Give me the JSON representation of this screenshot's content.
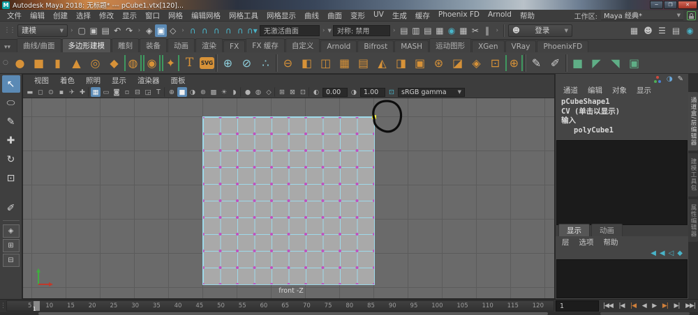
{
  "colors": {
    "accent-blue": "#5b8ab5",
    "shelf-orange": "#d79238",
    "icon-teal": "#49b4c9",
    "icon-green": "#5fae86",
    "wire-cyan": "#9ed9ea",
    "vertex-magenta": "#c052c0",
    "selected-yellow": "#f4ef3a",
    "viewport-gray": "#6a6a6a",
    "grid-line": "#5b5b5b",
    "face-gray": "#a9a9a9"
  },
  "titlebar": {
    "app_initial": "M",
    "title": "Autodesk Maya 2018: 无标题*  ---  pCube1.vtx[120]...",
    "minimize": "─",
    "maximize": "❐",
    "close": "✕"
  },
  "menubar": {
    "items": [
      {
        "name": "menu-file",
        "label": "文件"
      },
      {
        "name": "menu-edit",
        "label": "编辑"
      },
      {
        "name": "menu-create",
        "label": "创建"
      },
      {
        "name": "menu-select",
        "label": "选择"
      },
      {
        "name": "menu-modify",
        "label": "修改"
      },
      {
        "name": "menu-display",
        "label": "显示"
      },
      {
        "name": "menu-windows",
        "label": "窗口"
      },
      {
        "name": "menu-mesh",
        "label": "网格"
      },
      {
        "name": "menu-edit-mesh",
        "label": "编辑网格"
      },
      {
        "name": "menu-mesh-tools",
        "label": "网格工具"
      },
      {
        "name": "menu-mesh-display",
        "label": "网格显示"
      },
      {
        "name": "menu-curves",
        "label": "曲线"
      },
      {
        "name": "menu-surfaces",
        "label": "曲面"
      },
      {
        "name": "menu-deform",
        "label": "变形"
      },
      {
        "name": "menu-uv",
        "label": "UV"
      },
      {
        "name": "menu-generate",
        "label": "生成"
      },
      {
        "name": "menu-cache",
        "label": "缓存"
      },
      {
        "name": "menu-phoenix-fd",
        "label": "Phoenix FD"
      },
      {
        "name": "menu-arnold",
        "label": "Arnold"
      },
      {
        "name": "menu-help",
        "label": "帮助"
      }
    ],
    "workspace_label": "工作区:",
    "workspace_value": "Maya 经典*",
    "dropdown_arrow": "▼"
  },
  "statusline": {
    "mode": "建模",
    "no_active_surface": "无激活曲面",
    "symmetry": "对称: 禁用",
    "login": "登录",
    "file_icons": [
      {
        "name": "new-scene-icon",
        "glyph": "▢"
      },
      {
        "name": "open-scene-icon",
        "glyph": "▣"
      },
      {
        "name": "save-scene-icon",
        "glyph": "▤"
      },
      {
        "name": "undo-icon",
        "glyph": "↶"
      },
      {
        "name": "redo-icon",
        "glyph": "↷"
      }
    ],
    "selection_icons": [
      {
        "name": "select-hierarchy-icon",
        "glyph": "◈"
      },
      {
        "name": "select-object-icon",
        "glyph": "▣",
        "cls": "active"
      },
      {
        "name": "select-component-icon",
        "glyph": "◇"
      }
    ],
    "snap_icons": [
      {
        "name": "snap-to-grids-icon",
        "glyph": "∩",
        "cls": "teal"
      },
      {
        "name": "snap-to-curves-icon",
        "glyph": "∩",
        "cls": "teal"
      },
      {
        "name": "snap-to-points-icon",
        "glyph": "∩",
        "cls": "teal"
      },
      {
        "name": "snap-to-projected-center-icon",
        "glyph": "∩",
        "cls": "teal"
      },
      {
        "name": "snap-to-view-planes-icon",
        "glyph": "∩",
        "cls": "teal"
      },
      {
        "name": "make-live-icon",
        "glyph": "∩▾",
        "cls": "teal"
      }
    ],
    "render_icons": [
      {
        "name": "render-view-icon",
        "glyph": "▤"
      },
      {
        "name": "render-current-frame-icon",
        "glyph": "▥"
      },
      {
        "name": "ipr-render-icon",
        "glyph": "▤"
      },
      {
        "name": "render-setup-icon",
        "glyph": "▦"
      },
      {
        "name": "launch-render-view-icon",
        "glyph": "◉",
        "cls": "teal"
      },
      {
        "name": "render-settings-icon",
        "glyph": "▦"
      },
      {
        "name": "cut-icon",
        "glyph": "✂"
      },
      {
        "name": "pause-icon",
        "glyph": "‖"
      }
    ],
    "right_icons": [
      {
        "name": "modeling-toolkit-toggle-icon",
        "glyph": "▦"
      },
      {
        "name": "humanik-toggle-icon",
        "glyph": "☻"
      },
      {
        "name": "channel-box-toggle-icon",
        "glyph": "☰"
      },
      {
        "name": "attribute-editor-toggle-icon",
        "glyph": "▤"
      },
      {
        "name": "tool-settings-toggle-icon",
        "glyph": "◉",
        "cls": "teal"
      }
    ],
    "login_icon": "☻",
    "chevron": "›",
    "grip": "⋮⋮"
  },
  "shelf": {
    "tabs": [
      {
        "name": "shelf-tab-curves-surfaces",
        "label": "曲线/曲面"
      },
      {
        "name": "shelf-tab-poly-modeling",
        "label": "多边形建模",
        "cls": "active"
      },
      {
        "name": "shelf-tab-sculpting",
        "label": "雕刻"
      },
      {
        "name": "shelf-tab-rigging",
        "label": "装备"
      },
      {
        "name": "shelf-tab-animation",
        "label": "动画"
      },
      {
        "name": "shelf-tab-rendering",
        "label": "渲染"
      },
      {
        "name": "shelf-tab-fx",
        "label": "FX"
      },
      {
        "name": "shelf-tab-fx-caching",
        "label": "FX 缓存"
      },
      {
        "name": "shelf-tab-custom",
        "label": "自定义"
      },
      {
        "name": "shelf-tab-arnold",
        "label": "Arnold"
      },
      {
        "name": "shelf-tab-bifrost",
        "label": "Bifrost"
      },
      {
        "name": "shelf-tab-mash",
        "label": "MASH"
      },
      {
        "name": "shelf-tab-motion-graphics",
        "label": "运动图形"
      },
      {
        "name": "shelf-tab-xgen",
        "label": "XGen"
      },
      {
        "name": "shelf-tab-vray",
        "label": "VRay"
      },
      {
        "name": "shelf-tab-phoenixfd",
        "label": "PhoenixFD"
      }
    ],
    "icons": [
      {
        "name": "poly-sphere-icon",
        "glyph": "●"
      },
      {
        "name": "poly-cube-icon",
        "glyph": "■"
      },
      {
        "name": "poly-cylinder-icon",
        "glyph": "▮"
      },
      {
        "name": "poly-cone-icon",
        "glyph": "▲"
      },
      {
        "name": "poly-torus-icon",
        "glyph": "◎"
      },
      {
        "name": "poly-plane-icon",
        "glyph": "◆"
      },
      {
        "name": "poly-disc-icon",
        "glyph": "◍",
        "cls": "bracket"
      },
      {
        "name": "platonic-solid-icon",
        "glyph": "◉",
        "cls": "bracket"
      },
      {
        "name": "super-shape-icon",
        "glyph": "✦",
        "cls": "bracket"
      },
      {
        "name": "poly-text-icon",
        "glyph": "T",
        "cls": "textT"
      },
      {
        "name": "svg-tool-icon",
        "glyph": "SVG",
        "cls": "badge"
      },
      {
        "name": "shelf-separator",
        "glyph": "",
        "cls": "sepv"
      },
      {
        "name": "center-pivot-icon",
        "glyph": "⊕",
        "color": "#8ecfdd"
      },
      {
        "name": "delete-history-icon",
        "glyph": "⊘",
        "color": "#8ecfdd"
      },
      {
        "name": "zero-transforms-icon",
        "glyph": "∴",
        "color": "#8ecfdd"
      },
      {
        "name": "shelf-separator",
        "glyph": "",
        "cls": "sepv"
      },
      {
        "name": "combine-icon",
        "glyph": "⊖"
      },
      {
        "name": "boolean-icon",
        "glyph": "◧"
      },
      {
        "name": "mirror-icon",
        "glyph": "◫"
      },
      {
        "name": "fill-hole-icon",
        "glyph": "▦"
      },
      {
        "name": "reduce-icon",
        "glyph": "▤"
      },
      {
        "name": "smooth-icon",
        "glyph": "◭"
      },
      {
        "name": "extrude-icon",
        "glyph": "◨"
      },
      {
        "name": "bridge-icon",
        "glyph": "▣"
      },
      {
        "name": "circularize-icon",
        "glyph": "⊛"
      },
      {
        "name": "bevel-icon",
        "glyph": "◪"
      },
      {
        "name": "multi-cut-icon",
        "glyph": "◈"
      },
      {
        "name": "target-weld-icon",
        "glyph": "⊡"
      },
      {
        "name": "sphere-project-icon",
        "glyph": "⊕",
        "cls": "bracket"
      },
      {
        "name": "shelf-separator",
        "glyph": "",
        "cls": "sepv"
      },
      {
        "name": "create-curve-icon",
        "glyph": "✎",
        "color": "#cfcfcf"
      },
      {
        "name": "edit-points-icon",
        "glyph": "✐",
        "color": "#cfcfcf"
      },
      {
        "name": "shelf-separator",
        "glyph": "",
        "cls": "sepv"
      },
      {
        "name": "quad-draw-icon",
        "glyph": "■",
        "color": "#5fae86"
      },
      {
        "name": "relax-icon",
        "glyph": "◤",
        "color": "#5fae86"
      },
      {
        "name": "tweak-icon",
        "glyph": "◥",
        "color": "#5fae86"
      },
      {
        "name": "grab-icon",
        "glyph": "▣",
        "color": "#5fae86"
      }
    ]
  },
  "toolbox": {
    "tools": [
      {
        "name": "select-tool",
        "glyph": "↖",
        "cls": "active"
      },
      {
        "name": "lasso-select-tool",
        "glyph": "⬭"
      },
      {
        "name": "paint-select-tool",
        "glyph": "✎"
      },
      {
        "name": "move-tool",
        "glyph": "✚"
      },
      {
        "name": "rotate-tool",
        "glyph": "↻"
      },
      {
        "name": "scale-tool",
        "glyph": "⊡"
      },
      {
        "name": "tool-spacer",
        "glyph": "",
        "cls": "spacer"
      },
      {
        "name": "last-tool",
        "glyph": "✐"
      }
    ],
    "layouts": [
      {
        "name": "layout-single-pane-button",
        "glyph": "◈"
      },
      {
        "name": "layout-four-pane-button",
        "glyph": "⊞"
      },
      {
        "name": "layout-two-pane-button",
        "glyph": "⊟"
      }
    ]
  },
  "panel_menu": [
    {
      "name": "panel-menu-view",
      "label": "视图"
    },
    {
      "name": "panel-menu-shading",
      "label": "着色"
    },
    {
      "name": "panel-menu-lighting",
      "label": "照明"
    },
    {
      "name": "panel-menu-show",
      "label": "显示"
    },
    {
      "name": "panel-menu-renderer",
      "label": "渲染器"
    },
    {
      "name": "panel-menu-panels",
      "label": "面板"
    }
  ],
  "viewport_bar": {
    "icons": [
      {
        "name": "camera-attributes-icon",
        "glyph": "▬"
      },
      {
        "name": "bookmark-icon",
        "glyph": "◻"
      },
      {
        "name": "image-plane-icon",
        "glyph": "⊙"
      },
      {
        "name": "two-d-pan-zoom-icon",
        "glyph": "▪"
      },
      {
        "name": "oriented-camera-icon",
        "glyph": "✈"
      },
      {
        "name": "snap-pivot-icon",
        "glyph": "✚"
      },
      {
        "name": "vp-separator",
        "glyph": "",
        "cls": "sepv"
      },
      {
        "name": "grid-toggle-icon",
        "glyph": "▦",
        "cls": "active"
      },
      {
        "name": "film-gate-icon",
        "glyph": "▭"
      },
      {
        "name": "resolution-gate-icon",
        "glyph": "◙"
      },
      {
        "name": "gate-mask-icon",
        "glyph": "▫"
      },
      {
        "name": "field-chart-icon",
        "glyph": "⊟"
      },
      {
        "name": "safe-action-icon",
        "glyph": "◲"
      },
      {
        "name": "safe-title-icon",
        "glyph": "T"
      },
      {
        "name": "vp-separator",
        "glyph": "",
        "cls": "sepv"
      },
      {
        "name": "wireframe-display-icon",
        "glyph": "⊕"
      },
      {
        "name": "shaded-display-icon",
        "glyph": "■",
        "cls": "active"
      },
      {
        "name": "textured-display-icon",
        "glyph": "◑"
      },
      {
        "name": "lighting-display-icon",
        "glyph": "⊛"
      },
      {
        "name": "shadows-icon",
        "glyph": "▩"
      },
      {
        "name": "ao-icon",
        "glyph": "☀"
      },
      {
        "name": "motion-blur-icon",
        "glyph": "◗"
      },
      {
        "name": "vp-separator",
        "glyph": "",
        "cls": "sepv"
      },
      {
        "name": "isolate-select-icon",
        "glyph": "●"
      },
      {
        "name": "xray-icon",
        "glyph": "◍"
      },
      {
        "name": "joints-xray-icon",
        "glyph": "◇"
      },
      {
        "name": "vp-separator",
        "glyph": "",
        "cls": "sepv"
      },
      {
        "name": "layer-overrides-icon",
        "glyph": "⊞"
      },
      {
        "name": "texture-borders-icon",
        "glyph": "⊠"
      },
      {
        "name": "screen-space-icon",
        "glyph": "⊡"
      },
      {
        "name": "vp-separator",
        "glyph": "",
        "cls": "sepv"
      }
    ],
    "exposure_icon": "◐",
    "exposure": "0.00",
    "contrast_icon": "◑",
    "contrast": "1.00",
    "cms_icon": "⊡",
    "color_space": "sRGB gamma",
    "dropdown_arrow": "▼"
  },
  "viewport": {
    "camera_label": "front -Z",
    "object_name": "pCube1",
    "grid_divisions": 10,
    "selected_vertex": "vtx[120] (top-right corner, yellow)"
  },
  "channel_box": {
    "top_icons": [
      {
        "name": "show-connections-icon",
        "glyph": "∴"
      },
      {
        "name": "hide-show-icon",
        "glyph": "◑",
        "color": "#6aa7d8"
      },
      {
        "name": "edit-channels-icon",
        "glyph": "✎",
        "color": "#c9c9c9"
      }
    ],
    "menu": [
      {
        "name": "channel-box-menu-channels",
        "label": "通道"
      },
      {
        "name": "channel-box-menu-edit",
        "label": "编辑"
      },
      {
        "name": "channel-box-menu-object",
        "label": "对象"
      },
      {
        "name": "channel-box-menu-show",
        "label": "显示"
      }
    ],
    "node": "pCubeShape1",
    "cv_hint": "CV (单击以显示)",
    "inputs_label": "输入",
    "input_node": "polyCube1"
  },
  "layer_editor": {
    "tabs": [
      {
        "name": "layer-tab-display",
        "label": "显示",
        "cls": "active"
      },
      {
        "name": "layer-tab-anim",
        "label": "动画"
      }
    ],
    "menu": [
      {
        "name": "layer-menu-layers",
        "label": "层"
      },
      {
        "name": "layer-menu-options",
        "label": "选项"
      },
      {
        "name": "layer-menu-help",
        "label": "帮助"
      }
    ],
    "icons": [
      {
        "name": "new-empty-layer-icon",
        "glyph": "◀"
      },
      {
        "name": "new-layer-selected-icon",
        "glyph": "◀"
      },
      {
        "name": "new-layer-icon",
        "glyph": "◁"
      },
      {
        "name": "layer-options-icon",
        "glyph": "◆"
      }
    ]
  },
  "right_tabs": [
    {
      "name": "vtab-channel-box-layer-editor",
      "label": "通道盒/层编辑器",
      "cls": "active"
    },
    {
      "name": "vtab-modeling-toolkit",
      "label": "建模工具包"
    },
    {
      "name": "vtab-attribute-editor",
      "label": "属性编辑器"
    }
  ],
  "timeline": {
    "ticks": [
      "5",
      "10",
      "15",
      "20",
      "25",
      "30",
      "35",
      "40",
      "45",
      "50",
      "55",
      "60",
      "65",
      "70",
      "75",
      "80",
      "85",
      "90",
      "95",
      "100",
      "105",
      "110",
      "115",
      "120"
    ],
    "current_frame": "1",
    "frame_field": "1",
    "grip": "⋮",
    "playback": [
      {
        "name": "go-to-start-button",
        "glyph": "|◀◀"
      },
      {
        "name": "step-back-frame-button",
        "glyph": "|◀"
      },
      {
        "name": "step-back-key-button",
        "glyph": "|◀",
        "cls": "key"
      },
      {
        "name": "play-backwards-button",
        "glyph": "◀"
      },
      {
        "name": "play-forwards-button",
        "glyph": "▶"
      },
      {
        "name": "step-forward-key-button",
        "glyph": "▶|",
        "cls": "key"
      },
      {
        "name": "step-forward-frame-button",
        "glyph": "▶|"
      },
      {
        "name": "go-to-end-button",
        "glyph": "▶▶|"
      }
    ]
  }
}
